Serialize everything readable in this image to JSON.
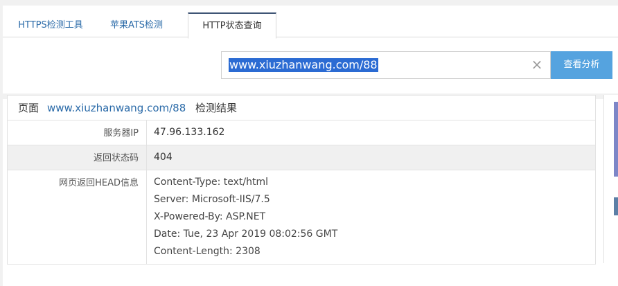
{
  "tabs": [
    {
      "label": "HTTPS检测工具",
      "active": false
    },
    {
      "label": "苹果ATS检测",
      "active": false
    },
    {
      "label": "HTTP状态查询",
      "active": true
    }
  ],
  "search": {
    "value": "www.xiuzhanwang.com/88",
    "clear_icon": "close-icon",
    "button_label": "查看分析"
  },
  "result": {
    "title_prefix": "页面",
    "title_url": "www.xiuzhanwang.com/88",
    "title_suffix": "检测结果",
    "rows": [
      {
        "label": "服务器IP",
        "value": "47.96.133.162"
      },
      {
        "label": "返回状态码",
        "value": "404"
      },
      {
        "label": "网页返回HEAD信息",
        "lines": [
          "Content-Type: text/html",
          "Server: Microsoft-IIS/7.5",
          "X-Powered-By: ASP.NET",
          "Date: Tue, 23 Apr 2019 08:02:56 GMT",
          "Content-Length: 2308"
        ]
      }
    ]
  },
  "colors": {
    "accent_button": "#55a3df",
    "link": "#2a6aa8",
    "selection": "#2b6bd3"
  }
}
